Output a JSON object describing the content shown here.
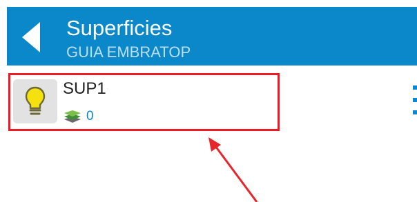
{
  "colors": {
    "accent": "#0b88c9",
    "highlight": "#ef1b24",
    "arrow": "#e8252a"
  },
  "app_bar": {
    "back_icon": "back-arrow-icon",
    "title": "Superficies",
    "subtitle": "GUIA EMBRATOP"
  },
  "list": {
    "items": [
      {
        "icon": "lightbulb-icon",
        "title": "SUP1",
        "layers_icon": "layers-icon",
        "count": "0"
      }
    ]
  },
  "overflow_icon": "overflow-menu-icon",
  "annotation": {
    "type": "arrow-pointing-to-highlighted-item"
  }
}
